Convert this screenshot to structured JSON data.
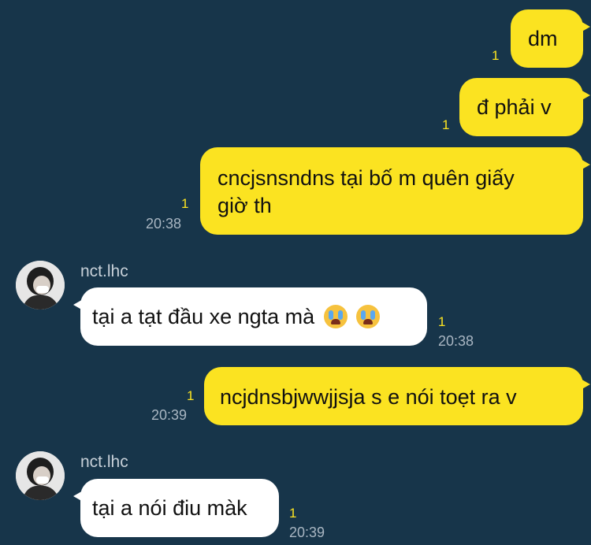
{
  "colors": {
    "background": "#17354a",
    "outgoing_bubble": "#fbe321",
    "incoming_bubble": "#ffffff",
    "unread_count": "#fbe321",
    "timestamp": "#a9b6c2"
  },
  "messages": [
    {
      "direction": "out",
      "text": "dm",
      "unread": "1",
      "time": ""
    },
    {
      "direction": "out",
      "text": "đ phải v",
      "unread": "1",
      "time": ""
    },
    {
      "direction": "out",
      "text_line1": "cncjsnsndns tại bố m quên giấy",
      "text_line2": "giờ th",
      "unread": "1",
      "time": "20:38"
    },
    {
      "direction": "in",
      "sender": "nct.lhc",
      "avatar_icon": "profile-photo-icon",
      "text": "tại a tạt đầu xe ngta mà",
      "emoji": "loudly-crying-face-icon",
      "unread": "1",
      "time": "20:38"
    },
    {
      "direction": "out",
      "text": "ncjdnsbjwwjjsja s e nói toẹt ra v",
      "unread": "1",
      "time": "20:39"
    },
    {
      "direction": "in",
      "sender": "nct.lhc",
      "avatar_icon": "profile-photo-icon",
      "text": "tại a nói điu màk",
      "unread": "1",
      "time": "20:39"
    }
  ]
}
